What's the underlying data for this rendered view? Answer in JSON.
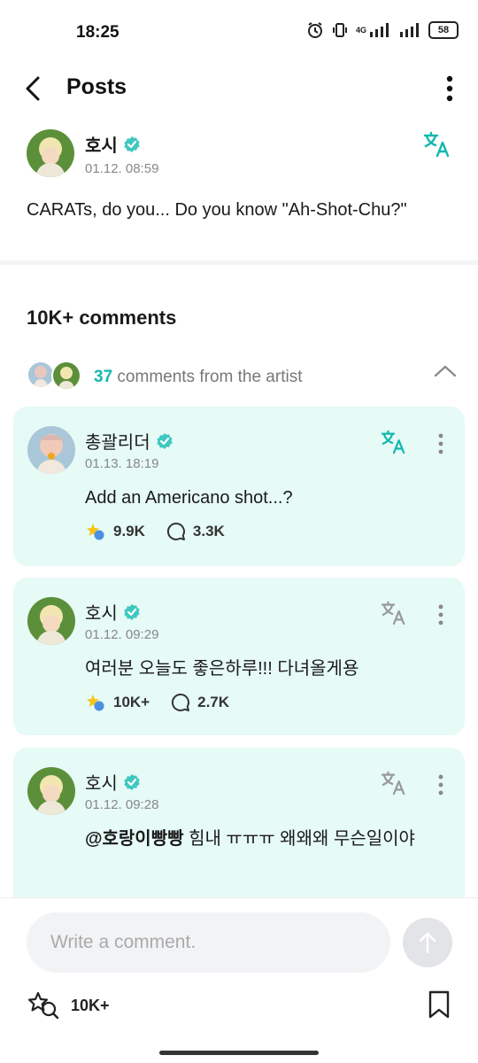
{
  "status_bar": {
    "time": "18:25",
    "network": "4G",
    "battery": "58",
    "icons": [
      "alarm-icon",
      "vibrate-icon",
      "signal-icon",
      "signal-icon",
      "battery-icon"
    ]
  },
  "header": {
    "title": "Posts",
    "back_icon": "chevron-left-icon",
    "menu_icon": "more-vertical-icon"
  },
  "post": {
    "author": "호시",
    "verified": true,
    "date": "01.12. 08:59",
    "text": "CARATs, do you... Do you know \"Ah-Shot-Chu?\""
  },
  "comments": {
    "count_label": "10K+ comments",
    "artist_summary": {
      "count": "37",
      "label": " comments from the artist"
    },
    "items": [
      {
        "author": "총괄리더",
        "verified": true,
        "date": "01.13. 18:19",
        "text": "Add an Americano shot...?",
        "likes": "9.9K",
        "replies": "3.3K",
        "translate_active": true
      },
      {
        "author": "호시",
        "verified": true,
        "date": "01.12. 09:29",
        "text": "여러분 오늘도 좋은하루!!! 다녀올게용",
        "likes": "10K+",
        "replies": "2.7K",
        "translate_active": false
      },
      {
        "author": "호시",
        "verified": true,
        "date": "01.12. 09:28",
        "mention": "@호랑이빵빵",
        "text": " 힘내 ㅠㅠㅠ 왜왜왜 무슨일이야",
        "translate_active": false
      }
    ]
  },
  "footer": {
    "placeholder": "Write a comment.",
    "likes": "10K+"
  },
  "colors": {
    "accent": "#12b8b0",
    "card_bg": "#e6faf6",
    "verified": "#3ec8c0"
  }
}
